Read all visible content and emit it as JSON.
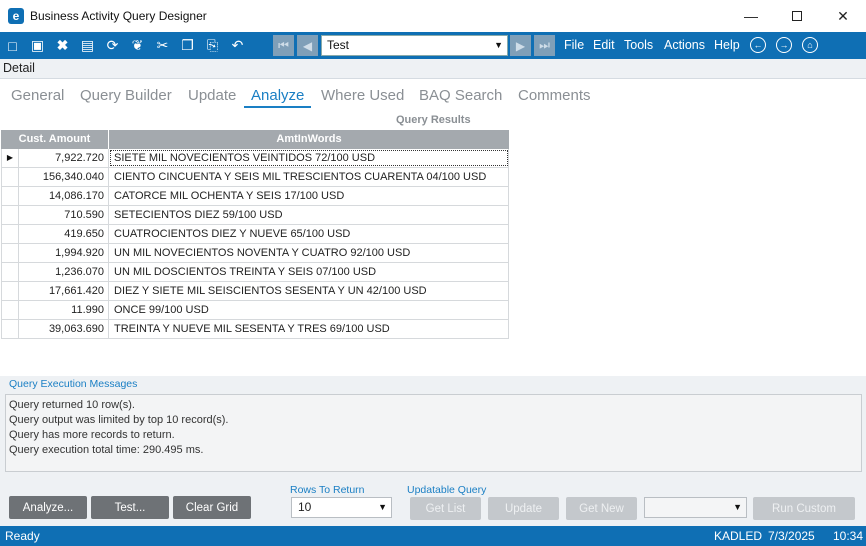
{
  "window": {
    "title": "Business Activity Query Designer",
    "app_icon": "e"
  },
  "toolbar": {
    "query_combo": "Test",
    "menus": [
      "File",
      "Edit",
      "Tools",
      "Actions",
      "Help"
    ]
  },
  "detail_label": "Detail",
  "tabs": [
    "General",
    "Query Builder",
    "Update",
    "Analyze",
    "Where Used",
    "BAQ Search",
    "Comments"
  ],
  "active_tab": "Analyze",
  "results": {
    "label": "Query Results",
    "columns": [
      "Cust. Amount",
      "AmtInWords"
    ],
    "rows": [
      [
        "7,922.720",
        "SIETE MIL NOVECIENTOS VEINTIDOS 72/100 USD"
      ],
      [
        "156,340.040",
        "CIENTO CINCUENTA Y SEIS MIL TRESCIENTOS CUARENTA 04/100 USD"
      ],
      [
        "14,086.170",
        "CATORCE MIL OCHENTA Y SEIS 17/100 USD"
      ],
      [
        "710.590",
        "SETECIENTOS DIEZ 59/100 USD"
      ],
      [
        "419.650",
        "CUATROCIENTOS DIEZ Y NUEVE 65/100 USD"
      ],
      [
        "1,994.920",
        "UN MIL NOVECIENTOS NOVENTA Y CUATRO 92/100 USD"
      ],
      [
        "1,236.070",
        "UN MIL DOSCIENTOS TREINTA Y SEIS 07/100 USD"
      ],
      [
        "17,661.420",
        "DIEZ Y SIETE MIL SEISCIENTOS SESENTA Y UN  42/100 USD"
      ],
      [
        "11.990",
        "ONCE 99/100 USD"
      ],
      [
        "39,063.690",
        "TREINTA Y NUEVE MIL SESENTA Y TRES 69/100 USD"
      ]
    ]
  },
  "messages": {
    "label": "Query Execution Messages",
    "lines": [
      "Query returned 10 row(s).",
      "Query output was limited by top 10 record(s).",
      "Query has more records to return.",
      "Query execution total time: 290.495 ms."
    ]
  },
  "bottom": {
    "analyze": "Analyze...",
    "test": "Test...",
    "clear_grid": "Clear Grid",
    "rows_label": "Rows To Return",
    "rows_value": "10",
    "updatable_label": "Updatable Query",
    "get_list": "Get List",
    "update": "Update",
    "get_new": "Get New",
    "custom_select": "",
    "run_custom": "Run Custom"
  },
  "status": {
    "state": "Ready",
    "user": "KADLED",
    "date": "7/3/2025",
    "time": "10:34"
  }
}
